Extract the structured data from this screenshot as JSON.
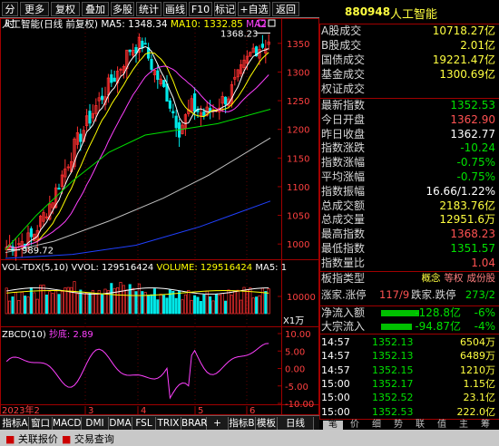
{
  "toolbar": {
    "buttons": [
      "分时",
      "更多",
      "复权",
      "叠加",
      "多股",
      "统计",
      "画线",
      "F10",
      "标记",
      "+自选",
      "返回"
    ]
  },
  "chart_title": {
    "name": "人工智能(日线 前复权)",
    "ma5_label": "MA5: 1348.34",
    "ma10_label": "MA10: 1332.85",
    "ma20_label": "MA2"
  },
  "price_axis": [
    "1350",
    "1300",
    "1250",
    "1200",
    "1150",
    "1100",
    "1050",
    "1000"
  ],
  "annotations": {
    "high": "1368.23",
    "low": "989.72"
  },
  "volume_title": {
    "name": "VOL-TDX(5,10)",
    "vvol": "VVOL: 129516424",
    "volume": "VOLUME: 129516424",
    "ma5": "MA5: 1"
  },
  "volume_axis": {
    "tick": "10000",
    "unit": "X1万"
  },
  "zbcd_title": {
    "name": "ZBCD(10)",
    "sub": "抄底: 2.89"
  },
  "zbcd_axis": [
    "10.00",
    "5.00",
    "0.00",
    "-5.00",
    "-10.00"
  ],
  "date_axis": {
    "year": "2023年2",
    "months": [
      "3",
      "4",
      "5",
      "6"
    ]
  },
  "bottom_tabs": [
    "指标A",
    "窗口",
    "MACD",
    "DMI",
    "DMA",
    "FSL",
    "TRIX",
    "BRAR",
    "+",
    "指标B",
    "模板",
    "日线"
  ],
  "quote_header": {
    "code": "880948",
    "name": "人工智能"
  },
  "quote_rows_a": [
    {
      "k": "A股成交",
      "v": "10718.27亿"
    },
    {
      "k": "B股成交",
      "v": "2.01亿"
    },
    {
      "k": "国债成交",
      "v": "19221.47亿"
    },
    {
      "k": "基金成交",
      "v": "1300.69亿"
    },
    {
      "k": "权证成交",
      "v": ""
    }
  ],
  "quote_rows_b": [
    {
      "k": "最新指数",
      "v": "1352.53",
      "c": "green"
    },
    {
      "k": "今日开盘",
      "v": "1362.90",
      "c": "red"
    },
    {
      "k": "昨日收盘",
      "v": "1362.77",
      "c": "white"
    },
    {
      "k": "指数涨跌",
      "v": "-10.24",
      "c": "green"
    },
    {
      "k": "指数涨幅",
      "v": "-0.75%",
      "c": "green"
    },
    {
      "k": "平均涨幅",
      "v": "-0.75%",
      "c": "green"
    },
    {
      "k": "指数振幅",
      "v": "16.66/1.22%",
      "c": "white"
    },
    {
      "k": "总成交额",
      "v": "2183.76亿",
      "c": "yel"
    },
    {
      "k": "总成交量",
      "v": "12951.6万",
      "c": "yel"
    },
    {
      "k": "最高指数",
      "v": "1368.23",
      "c": "red"
    },
    {
      "k": "最低指数",
      "v": "1351.57",
      "c": "green"
    },
    {
      "k": "指数量比",
      "v": "1.04",
      "c": "red"
    }
  ],
  "sector": {
    "label": "板指类型",
    "types": [
      "概念",
      "等权",
      "成份股"
    ]
  },
  "limit_row": {
    "up_label": "涨家.涨停",
    "up_value": "117/9",
    "down_label": "跌家.跌停",
    "down_value": "273/2"
  },
  "flows": [
    {
      "label": "净流入额",
      "value": "-128.8亿",
      "pct": "-6%"
    },
    {
      "label": "大宗流入",
      "value": "-94.87亿",
      "pct": "-4%"
    }
  ],
  "ticks": [
    {
      "t": "14:57",
      "p": "1352.13",
      "v": "6504万"
    },
    {
      "t": "14:57",
      "p": "1352.13",
      "v": "6489万"
    },
    {
      "t": "14:57",
      "p": "1352.15",
      "v": "1210万"
    },
    {
      "t": "15:00",
      "p": "1352.17",
      "v": "1.15亿"
    },
    {
      "t": "15:00",
      "p": "1352.52",
      "v": "23.1亿"
    },
    {
      "t": "15:00",
      "p": "1352.53",
      "v": "222.0亿"
    }
  ],
  "side_tabs": [
    "笔",
    "价",
    "细",
    "势",
    "联",
    "值",
    "主",
    "筹"
  ],
  "status": {
    "left": "关联报价",
    "right": "交易查询"
  },
  "colors": {
    "up": "#ff3030",
    "down": "#00e8e8",
    "ma5": "#ffffff",
    "ma10": "#ffff00",
    "ma20": "#ff40ff",
    "ma60": "#00e000",
    "ma120": "#c0c0c0",
    "ma250": "#2040ff"
  }
}
